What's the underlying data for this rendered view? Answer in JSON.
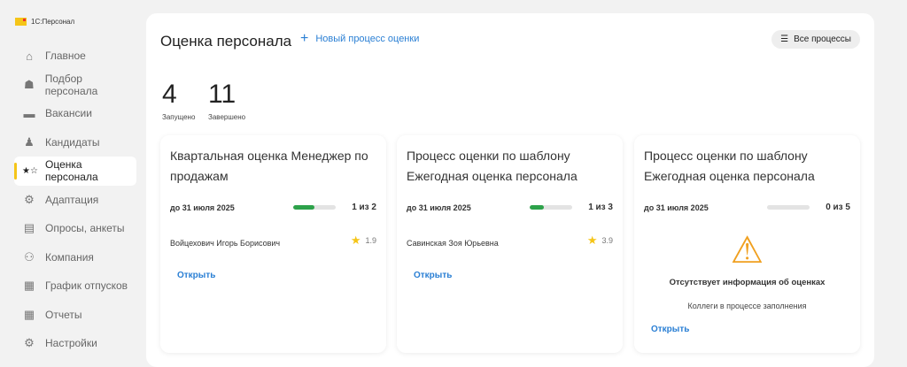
{
  "app": {
    "name": "1С:Персонал"
  },
  "sidebar": {
    "items": [
      {
        "label": "Главное",
        "icon": "⌂"
      },
      {
        "label": "Подбор персонала",
        "icon": "☗"
      },
      {
        "label": "Вакансии",
        "icon": "▬"
      },
      {
        "label": "Кандидаты",
        "icon": "♟"
      },
      {
        "label": "Оценка персонала",
        "icon": "★☆"
      },
      {
        "label": "Адаптация",
        "icon": "⚙"
      },
      {
        "label": "Опросы, анкеты",
        "icon": "▤"
      },
      {
        "label": "Компания",
        "icon": "⚇"
      },
      {
        "label": "График отпусков",
        "icon": "▦"
      },
      {
        "label": "Отчеты",
        "icon": "▦"
      },
      {
        "label": "Настройки",
        "icon": "⚙"
      }
    ]
  },
  "header": {
    "title": "Оценка персонала",
    "new_process": "Новый процесс оценки",
    "all_processes": "Все процессы"
  },
  "stats": [
    {
      "value": "4",
      "label": "Запущено"
    },
    {
      "value": "11",
      "label": "Завершено"
    }
  ],
  "cards": [
    {
      "title": "Квартальная оценка Менеджер по продажам",
      "deadline": "до 31 июля 2025",
      "progress": 0.5,
      "count": "1 из 2",
      "person": "Войцехович Игорь Борисович",
      "rating": "1.9",
      "open": "Открыть"
    },
    {
      "title": "Процесс оценки по шаблону Ежегодная оценка персонала",
      "deadline": "до 31 июля 2025",
      "progress": 0.333,
      "count": "1 из 3",
      "person": "Савинская Зоя Юрьевна",
      "rating": "3.9",
      "open": "Открыть"
    },
    {
      "title": "Процесс оценки по шаблону Ежегодная оценка персонала",
      "deadline": "до 31 июля 2025",
      "progress": 0,
      "count": "0 из 5",
      "warning_title": "Отсутствует информация об оценках",
      "warning_text": "Коллеги в процессе заполнения",
      "open": "Открыть"
    }
  ],
  "colors": {
    "accent": "#2a7fd4",
    "progress": "#2da24a",
    "active": "#f5c518",
    "warning": "#f0a020"
  }
}
